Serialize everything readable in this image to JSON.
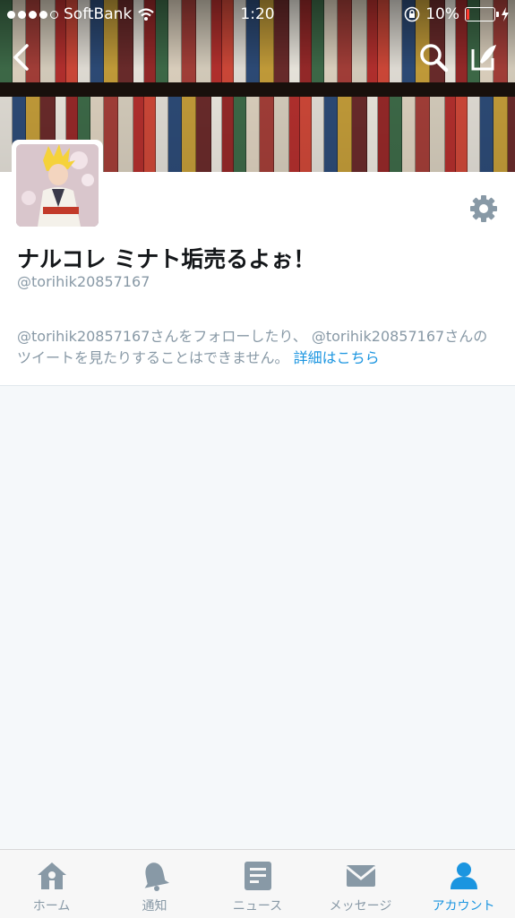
{
  "status_bar": {
    "carrier": "SoftBank",
    "time": "1:20",
    "battery_percent": "10%",
    "battery_level": 0.1
  },
  "header_actions": {
    "back": "back-icon",
    "search": "search-icon",
    "compose": "compose-icon"
  },
  "profile": {
    "display_name": "ナルコレ ミナト垢売るよぉ！",
    "handle": "@torihik20857167",
    "notice_text": "@torihik20857167さんをフォローしたり、 @torihik20857167さんのツイートを見たりすることはできません。",
    "notice_link": "詳細はこちら"
  },
  "tabs": [
    {
      "label": "ホーム",
      "icon": "home-icon",
      "active": false
    },
    {
      "label": "通知",
      "icon": "bell-icon",
      "active": false
    },
    {
      "label": "ニュース",
      "icon": "news-icon",
      "active": false
    },
    {
      "label": "メッセージ",
      "icon": "envelope-icon",
      "active": false
    },
    {
      "label": "アカウント",
      "icon": "person-icon",
      "active": true
    }
  ],
  "colors": {
    "accent": "#1b95e0",
    "muted": "#8899a6",
    "inactive_icon": "#8899a6"
  }
}
